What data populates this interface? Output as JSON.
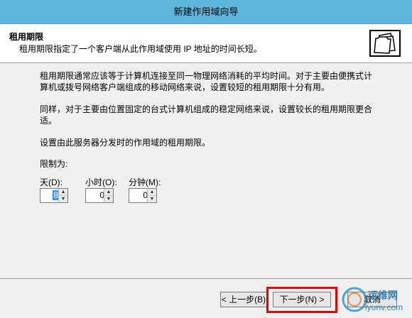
{
  "window": {
    "title": "新建作用域向导"
  },
  "header": {
    "title": "租用期限",
    "subtitle": "租用期限指定了一个客户端从此作用域使用 IP 地址的时间长短。"
  },
  "content": {
    "paragraph1": "租用期限通常应该等于计算机连接至同一物理网络消耗的平均时间。对于主要由便携式计算机或拨号网络客户端组成的移动网络来说，设置较短的租用期限十分有用。",
    "paragraph2": "同样，对于主要由位置固定的台式计算机组成的稳定网络来说，设置较长的租用期限更合适。",
    "paragraph3": "设置由此服务器分发时的作用域的租用期限。",
    "limit_label": "限制为:",
    "days": {
      "label": "天(D):",
      "value": "8"
    },
    "hours": {
      "label": "小时(O):",
      "value": "0"
    },
    "minutes": {
      "label": "分钟(M):",
      "value": "0"
    }
  },
  "buttons": {
    "back": "< 上一步(B)",
    "next": "下一步(N) >",
    "cancel": "取消"
  },
  "watermark": {
    "brand": "运维网",
    "url": "iyunv.com"
  }
}
